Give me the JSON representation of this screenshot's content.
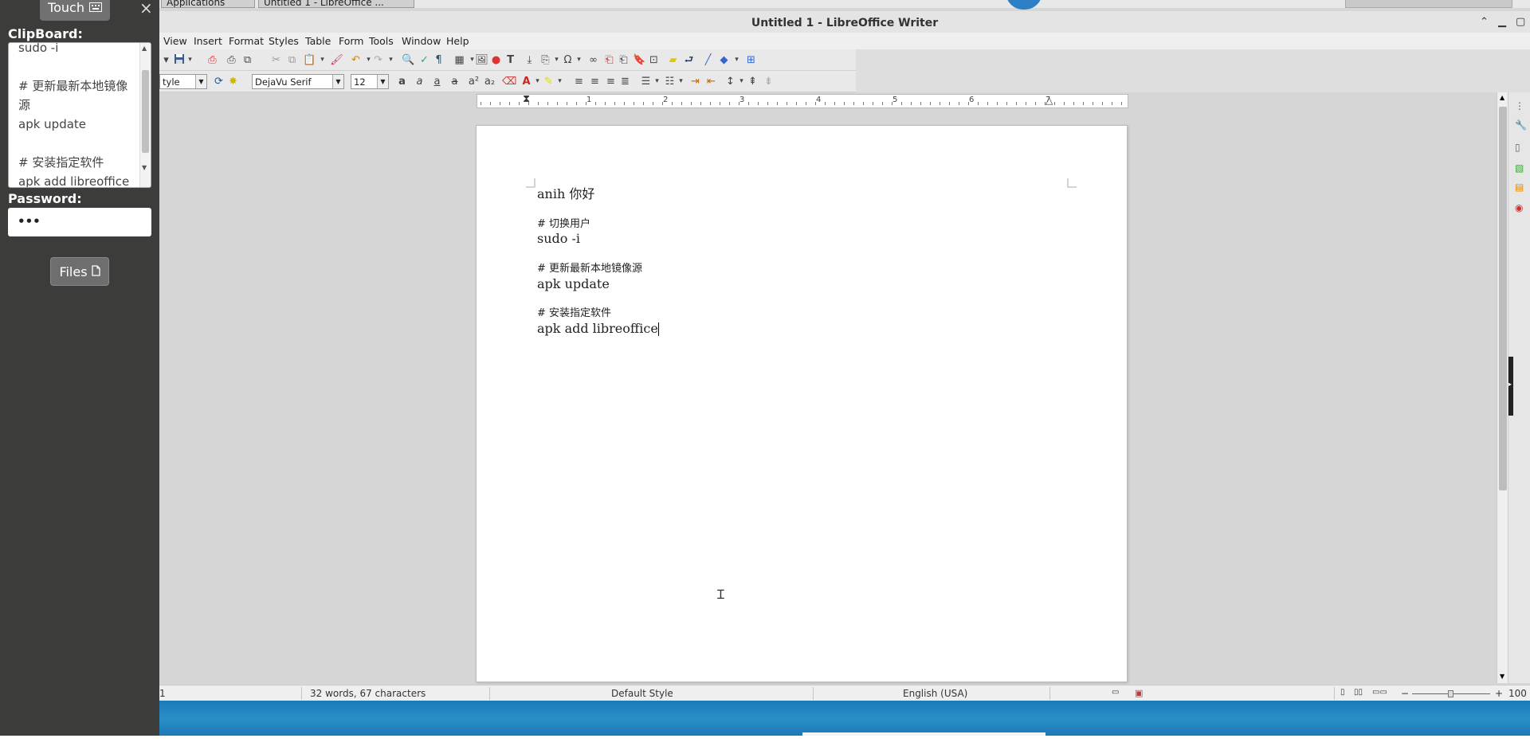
{
  "panel": {
    "touch_label": "Touch",
    "touch_icon": "keyboard-icon",
    "close_glyph": "×",
    "clipboard_label": "ClipBoard:",
    "clipboard_text": "sudo -i\n\n# 更新最新本地镜像源\napk update\n\n# 安装指定软件\napk add libreoffice",
    "password_label": "Password:",
    "password_value": "•••",
    "files_label": "Files"
  },
  "taskbar": {
    "items": [
      "Applications",
      "Untitled 1 - LibreOffice ..."
    ]
  },
  "window": {
    "title": "Untitled 1 - LibreOffice Writer"
  },
  "menu": [
    "View",
    "Insert",
    "Format",
    "Styles",
    "Table",
    "Form",
    "Tools",
    "Window",
    "Help"
  ],
  "formatting": {
    "paragraph_style": "tyle",
    "font_name": "DejaVu Serif",
    "font_size": "12"
  },
  "ruler": {
    "numbers": [
      "1",
      "2",
      "3",
      "4",
      "5",
      "6",
      "7"
    ]
  },
  "document": {
    "lines": [
      {
        "text": "anih 你好",
        "kind": "normal"
      },
      {
        "text": "",
        "kind": "blank"
      },
      {
        "text": "# 切换用户",
        "kind": "zh"
      },
      {
        "text": "sudo -i",
        "kind": "normal"
      },
      {
        "text": "",
        "kind": "blank"
      },
      {
        "text": "# 更新最新本地镜像源",
        "kind": "zh"
      },
      {
        "text": "apk update",
        "kind": "normal"
      },
      {
        "text": "",
        "kind": "blank"
      },
      {
        "text": "# 安装指定软件",
        "kind": "zh"
      },
      {
        "text": "apk add libreoffice",
        "kind": "normal"
      }
    ]
  },
  "status": {
    "page": "1",
    "words": "32 words, 67 characters",
    "page_style": "Default Style",
    "language": "English (USA)",
    "zoom": "100"
  },
  "colors": {
    "panel_bg": "#3c3c3a",
    "desktop": "#1f80bd"
  }
}
